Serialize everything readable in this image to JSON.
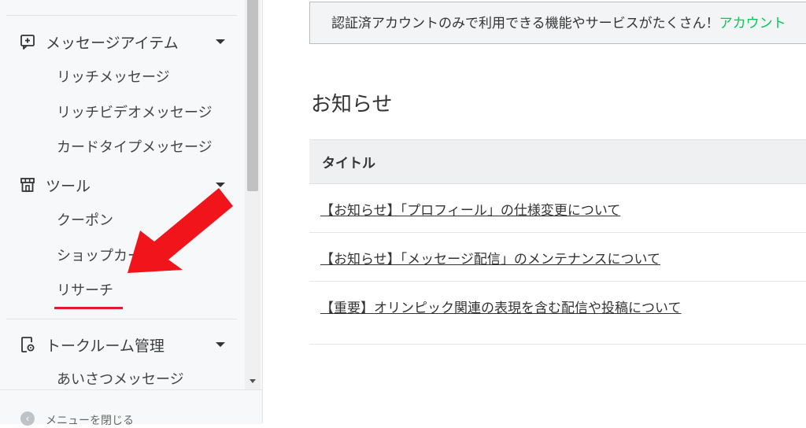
{
  "sidebar": {
    "sections": [
      {
        "label": "メッセージアイテム",
        "icon": "message-plus-icon",
        "items": [
          "リッチメッセージ",
          "リッチビデオメッセージ",
          "カードタイプメッセージ"
        ]
      },
      {
        "label": "ツール",
        "icon": "shop-icon",
        "items": [
          "クーポン",
          "ショップカード",
          "リサーチ"
        ]
      },
      {
        "label": "トークルーム管理",
        "icon": "chat-settings-icon",
        "items": [
          "あいさつメッセージ"
        ]
      }
    ],
    "footer_label": "メニューを閉じる"
  },
  "banner": {
    "text": "認証済アカウントのみで利用できる機能やサービスがたくさん！",
    "link": "アカウント"
  },
  "page_title": "お知らせ",
  "table": {
    "header": "タイトル",
    "rows": [
      "【お知らせ】「プロフィール」の仕様変更について",
      "【お知らせ】「メッセージ配信」のメンテナンスについて",
      "【重要】オリンピック関連の表現を含む配信や投稿について"
    ]
  },
  "colors": {
    "accent_green": "#06c755",
    "highlight_red": "#e8192c"
  }
}
